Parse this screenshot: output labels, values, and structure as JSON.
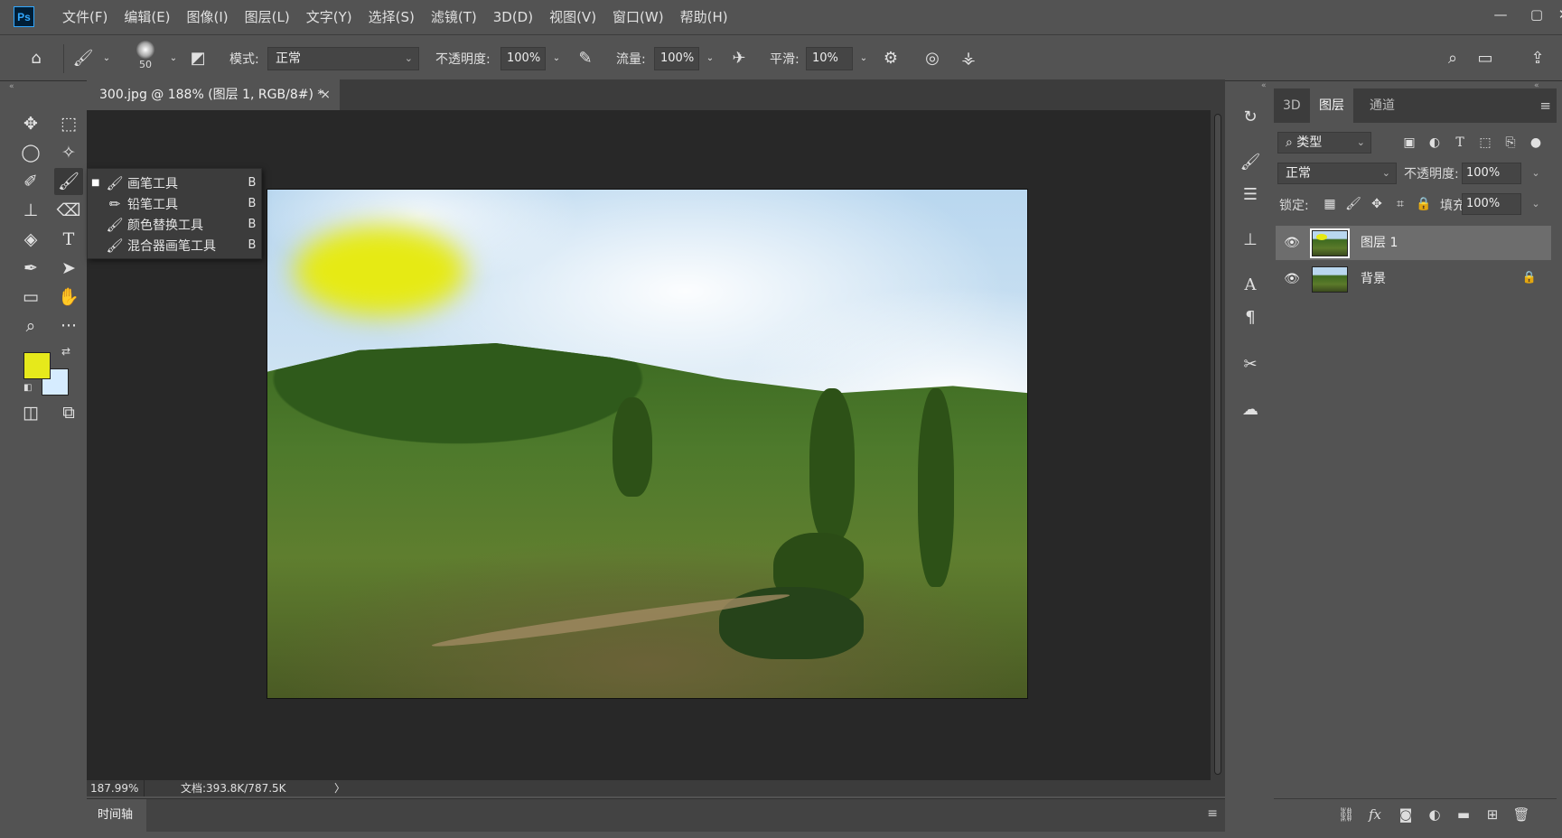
{
  "app": {
    "logo": "Ps"
  },
  "menu": [
    "文件(F)",
    "编辑(E)",
    "图像(I)",
    "图层(L)",
    "文字(Y)",
    "选择(S)",
    "滤镜(T)",
    "3D(D)",
    "视图(V)",
    "窗口(W)",
    "帮助(H)"
  ],
  "window_controls": {
    "minimize": "—",
    "maximize": "▢",
    "close": "✕"
  },
  "options": {
    "brush_size": "50",
    "mode_label": "模式:",
    "mode_value": "正常",
    "opacity_label": "不透明度:",
    "opacity_value": "100%",
    "flow_label": "流量:",
    "flow_value": "100%",
    "smooth_label": "平滑:",
    "smooth_value": "10%"
  },
  "flyout": [
    {
      "label": "画笔工具",
      "key": "B",
      "active": true
    },
    {
      "label": "铅笔工具",
      "key": "B",
      "active": false
    },
    {
      "label": "颜色替换工具",
      "key": "B",
      "active": false
    },
    {
      "label": "混合器画笔工具",
      "key": "B",
      "active": false
    }
  ],
  "colors": {
    "foreground": "#e6e91b",
    "background": "#d6ecff",
    "accent": "#31a8ff"
  },
  "document": {
    "tab_title": "300.jpg @ 188% (图层 1, RGB/8#) *",
    "close": "×"
  },
  "status": {
    "zoom": "187.99%",
    "doc_info": "文档:393.8K/787.5K",
    "arrow": "〉"
  },
  "timeline": {
    "label": "时间轴"
  },
  "layers_panel": {
    "tabs": [
      "3D",
      "图层",
      "通道"
    ],
    "active_tab": "图层",
    "filter_kind": "类型",
    "blend_mode": "正常",
    "opacity_label": "不透明度:",
    "opacity_value": "100%",
    "lock_label": "锁定:",
    "fill_label": "填充:",
    "fill_value": "100%",
    "layers": [
      {
        "name": "图层 1",
        "selected": true,
        "locked": false
      },
      {
        "name": "背景",
        "selected": false,
        "locked": true
      }
    ]
  }
}
